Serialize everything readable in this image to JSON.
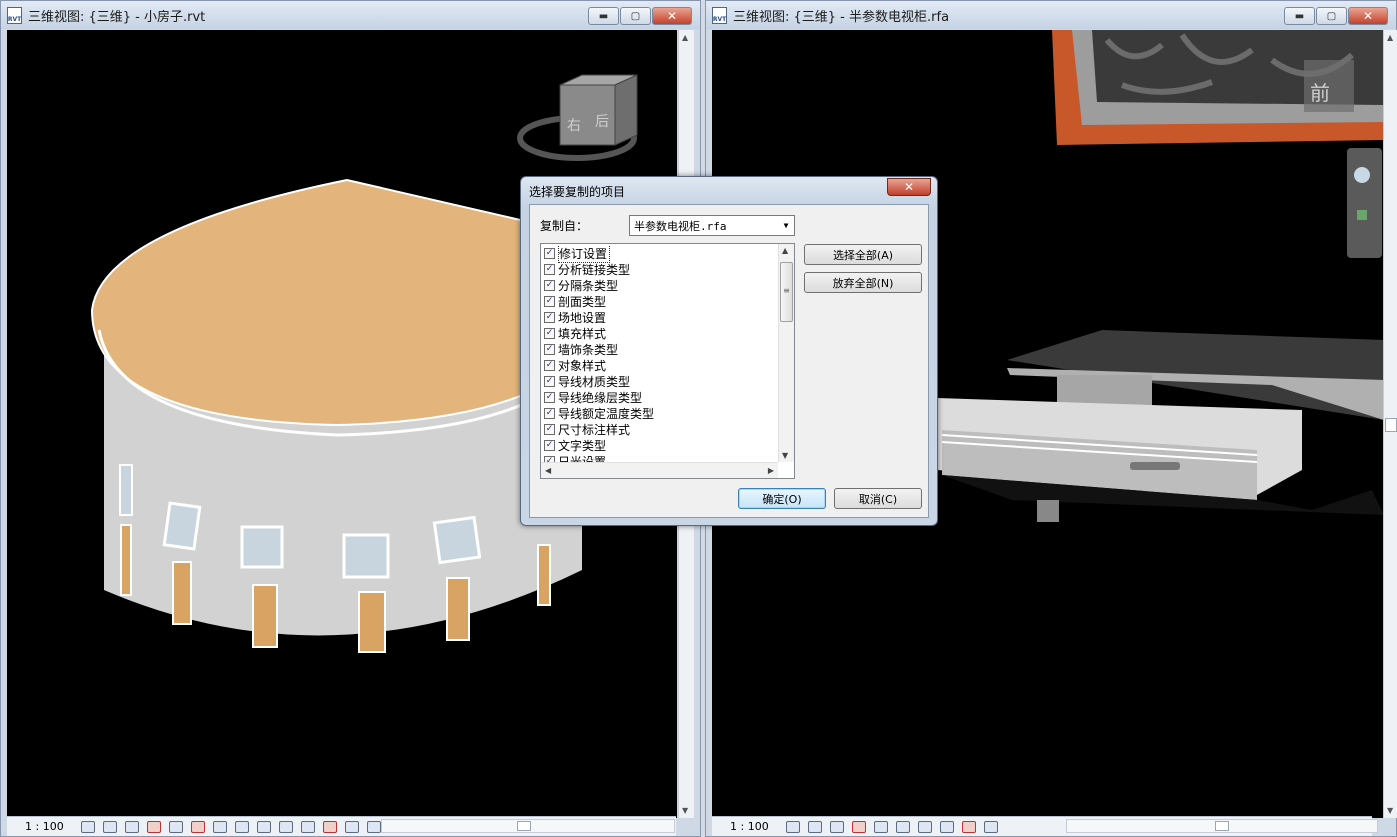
{
  "left_window": {
    "title": "三维视图: {三维} - 小房子.rvt",
    "scale": "1 : 100",
    "viewcube_labels": [
      "右",
      "后"
    ]
  },
  "right_window": {
    "title": "三维视图: {三维} - 半参数电视柜.rfa",
    "scale": "1 : 100",
    "viewcube_label": "前"
  },
  "window_buttons": {
    "minimize": "▬",
    "maximize": "▢",
    "close": "✕"
  },
  "dialog": {
    "title": "选择要复制的项目",
    "close": "✕",
    "copy_from_label": "复制自：",
    "copy_from_value": "半参数电视柜.rfa",
    "items": [
      {
        "label": "修订设置",
        "checked": true
      },
      {
        "label": "分析链接类型",
        "checked": true
      },
      {
        "label": "分隔条类型",
        "checked": true
      },
      {
        "label": "剖面类型",
        "checked": true
      },
      {
        "label": "场地设置",
        "checked": true
      },
      {
        "label": "填充样式",
        "checked": true
      },
      {
        "label": "墙饰条类型",
        "checked": true
      },
      {
        "label": "对象样式",
        "checked": true
      },
      {
        "label": "导线材质类型",
        "checked": true
      },
      {
        "label": "导线绝缘层类型",
        "checked": true
      },
      {
        "label": "导线额定温度类型",
        "checked": true
      },
      {
        "label": "尺寸标注样式",
        "checked": true
      },
      {
        "label": "文字类型",
        "checked": true
      },
      {
        "label": "日光设置",
        "checked": true
      }
    ],
    "select_all": "选择全部(A)",
    "clear_all": "放弃全部(N)",
    "ok": "确定(O)",
    "cancel": "取消(C)"
  },
  "colors": {
    "roof": "#e3b57c",
    "wall": "#d2d2d2",
    "door": "#d9a463",
    "frame": "#c8582a",
    "viewport_bg": "#000000"
  }
}
